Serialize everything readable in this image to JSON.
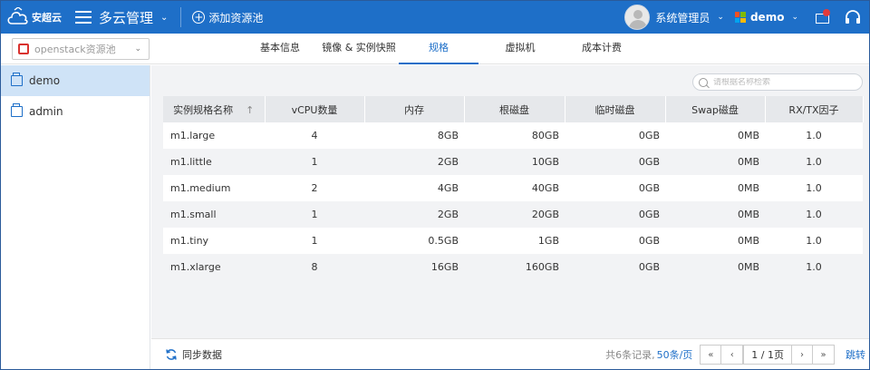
{
  "brand": {
    "logo_text": "安超云",
    "accent": "#1e6fc8"
  },
  "header": {
    "title": "多云管理",
    "add_pool_label": "添加资源池",
    "user_name": "系统管理员",
    "tenant_name": "demo"
  },
  "pool_select": {
    "value": "openstack资源池"
  },
  "tabs": [
    {
      "label": "基本信息"
    },
    {
      "label": "镜像 & 实例快照"
    },
    {
      "label": "规格",
      "active": true
    },
    {
      "label": "虚拟机"
    },
    {
      "label": "成本计费"
    }
  ],
  "sidebar": {
    "items": [
      {
        "label": "demo",
        "active": true
      },
      {
        "label": "admin"
      }
    ]
  },
  "search": {
    "placeholder": "请根据名称检索"
  },
  "table": {
    "columns": [
      "实例规格名称",
      "vCPU数量",
      "内存",
      "根磁盘",
      "临时磁盘",
      "Swap磁盘",
      "RX/TX因子"
    ],
    "sort_indicator": "↑",
    "rows": [
      [
        "m1.large",
        "4",
        "8GB",
        "80GB",
        "0GB",
        "0MB",
        "1.0"
      ],
      [
        "m1.little",
        "1",
        "2GB",
        "10GB",
        "0GB",
        "0MB",
        "1.0"
      ],
      [
        "m1.medium",
        "2",
        "4GB",
        "40GB",
        "0GB",
        "0MB",
        "1.0"
      ],
      [
        "m1.small",
        "1",
        "2GB",
        "20GB",
        "0GB",
        "0MB",
        "1.0"
      ],
      [
        "m1.tiny",
        "1",
        "0.5GB",
        "1GB",
        "0GB",
        "0MB",
        "1.0"
      ],
      [
        "m1.xlarge",
        "8",
        "16GB",
        "160GB",
        "0GB",
        "0MB",
        "1.0"
      ]
    ]
  },
  "footer": {
    "sync_label": "同步数据",
    "total_label": "共6条记录,",
    "per_page_label": "50条/页",
    "first_btn": "«",
    "prev_btn": "‹",
    "page_label": "1 / 1页",
    "next_btn": "›",
    "last_btn": "»",
    "jump_label": "跳转"
  }
}
